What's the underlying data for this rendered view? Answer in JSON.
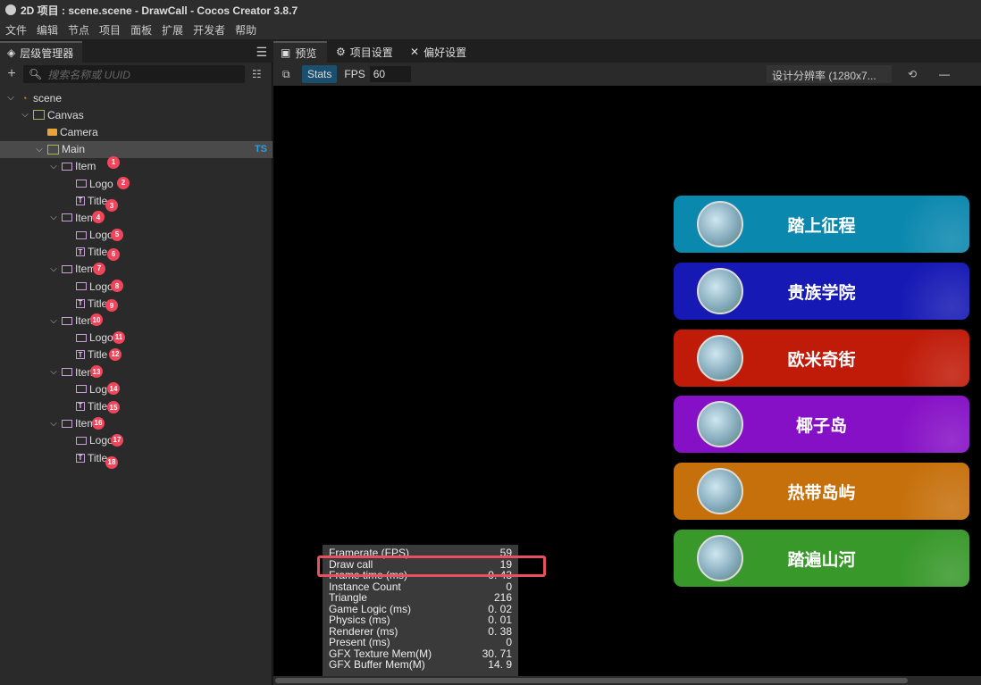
{
  "window": {
    "title": "2D 项目 : scene.scene - DrawCall - Cocos Creator 3.8.7"
  },
  "menu": [
    "文件",
    "编辑",
    "节点",
    "项目",
    "面板",
    "扩展",
    "开发者",
    "帮助"
  ],
  "hierarchy": {
    "tab": "层级管理器",
    "search_placeholder": "搜索名称或 UUID",
    "nodes": [
      {
        "label": "scene",
        "depth": 0,
        "icon": "scene",
        "caret": "v"
      },
      {
        "label": "Canvas",
        "depth": 1,
        "icon": "canvas",
        "caret": "v"
      },
      {
        "label": "Camera",
        "depth": 2,
        "icon": "camera",
        "caret": ""
      },
      {
        "label": "Main",
        "depth": 2,
        "icon": "canvas",
        "caret": "v",
        "selected": true,
        "tag": "TS"
      },
      {
        "label": "Item",
        "depth": 3,
        "icon": "sprite",
        "caret": "v",
        "badge": "1"
      },
      {
        "label": "Logo",
        "depth": 4,
        "icon": "sprite",
        "caret": "",
        "badge": "2"
      },
      {
        "label": "Title",
        "depth": 4,
        "icon": "label",
        "caret": "",
        "badge": "3"
      },
      {
        "label": "Item",
        "depth": 3,
        "icon": "sprite",
        "caret": "v",
        "badge": "4"
      },
      {
        "label": "Logo",
        "depth": 4,
        "icon": "sprite",
        "caret": "",
        "badge": "5"
      },
      {
        "label": "Title",
        "depth": 4,
        "icon": "label",
        "caret": "",
        "badge": "6"
      },
      {
        "label": "Item",
        "depth": 3,
        "icon": "sprite",
        "caret": "v",
        "badge": "7"
      },
      {
        "label": "Logo",
        "depth": 4,
        "icon": "sprite",
        "caret": "",
        "badge": "8"
      },
      {
        "label": "Title",
        "depth": 4,
        "icon": "label",
        "caret": "",
        "badge": "9"
      },
      {
        "label": "Item",
        "depth": 3,
        "icon": "sprite",
        "caret": "v",
        "badge": "10"
      },
      {
        "label": "Logo",
        "depth": 4,
        "icon": "sprite",
        "caret": "",
        "badge": "11"
      },
      {
        "label": "Title",
        "depth": 4,
        "icon": "label",
        "caret": "",
        "badge": "12"
      },
      {
        "label": "Item",
        "depth": 3,
        "icon": "sprite",
        "caret": "v",
        "badge": "13"
      },
      {
        "label": "Logo",
        "depth": 4,
        "icon": "sprite",
        "caret": "",
        "badge": "14"
      },
      {
        "label": "Title",
        "depth": 4,
        "icon": "label",
        "caret": "",
        "badge": "15"
      },
      {
        "label": "Item",
        "depth": 3,
        "icon": "sprite",
        "caret": "v",
        "badge": "16"
      },
      {
        "label": "Logo",
        "depth": 4,
        "icon": "sprite",
        "caret": "",
        "badge": "17"
      },
      {
        "label": "Title",
        "depth": 4,
        "icon": "label",
        "caret": "",
        "badge": "18"
      }
    ]
  },
  "preview": {
    "tabs": [
      "预览",
      "项目设置",
      "偏好设置"
    ],
    "stats_label": "Stats",
    "fps_label": "FPS",
    "fps_value": "60",
    "resolution": "设计分辨率 (1280x7..."
  },
  "cards": [
    {
      "title": "踏上征程",
      "color": "#0b88ae"
    },
    {
      "title": "贵族学院",
      "color": "#1619b4"
    },
    {
      "title": "欧米奇街",
      "color": "#c01a08"
    },
    {
      "title": "椰子岛",
      "color": "#8610c6"
    },
    {
      "title": "热带岛屿",
      "color": "#c6700c"
    },
    {
      "title": "踏遍山河",
      "color": "#38982a"
    }
  ],
  "stats": [
    {
      "k": "Framerate (FPS)",
      "v": "59"
    },
    {
      "k": "Draw call",
      "v": "19"
    },
    {
      "k": "Frame time (ms)",
      "v": "0. 43"
    },
    {
      "k": "Instance Count",
      "v": "0"
    },
    {
      "k": "Triangle",
      "v": "216"
    },
    {
      "k": "Game Logic (ms)",
      "v": "0. 02"
    },
    {
      "k": "Physics (ms)",
      "v": "0. 01"
    },
    {
      "k": "Renderer (ms)",
      "v": "0. 38"
    },
    {
      "k": "Present (ms)",
      "v": "0"
    },
    {
      "k": "GFX Texture Mem(M)",
      "v": "30. 71"
    },
    {
      "k": "GFX Buffer Mem(M)",
      "v": "14. 9"
    }
  ]
}
